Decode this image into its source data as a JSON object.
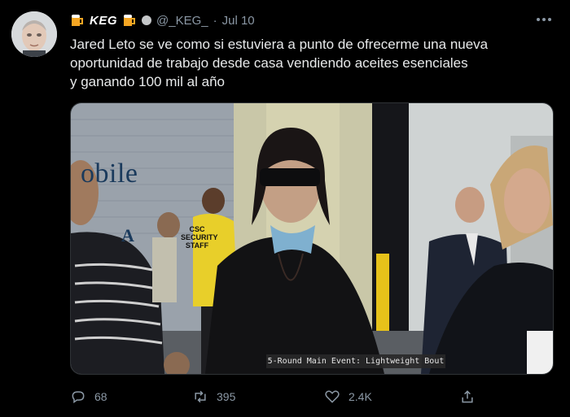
{
  "tweet": {
    "display_name": "KEG",
    "handle": "@_KEG_",
    "separator": "·",
    "date": "Jul 10",
    "text_lines": [
      "Jared Leto se ve como si estuviera a punto de ofrecerme una nueva",
      "oportunidad de trabajo desde casa vendiendo aceites esenciales",
      "y ganando 100 mil al año"
    ],
    "media": {
      "caption": "5-Round Main Event: Lightweight Bout",
      "wall_sign": "obile",
      "wall_sign_2": "A",
      "vest_text": "CSC SECURITY STAFF"
    },
    "actions": {
      "reply_count": "68",
      "retweet_count": "395",
      "like_count": "2.4K"
    }
  },
  "colors": {
    "background": "#000000",
    "text": "#e7e9ea",
    "secondary": "#8b98a5"
  },
  "icons": [
    "beer-mug-icon",
    "verified-style-badge-icon",
    "more-dots-icon",
    "reply-icon",
    "retweet-icon",
    "like-heart-icon",
    "share-icon"
  ]
}
